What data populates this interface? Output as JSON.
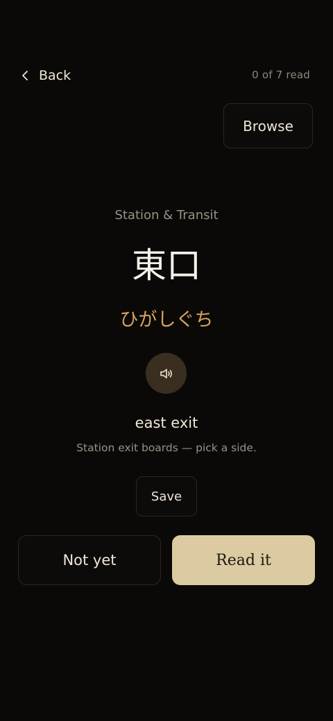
{
  "header": {
    "back_label": "Back",
    "back_icon": "chevron-left-icon",
    "progress_text": "0 of 7 read"
  },
  "toolbar": {
    "browse_label": "Browse"
  },
  "card": {
    "category": "Station & Transit",
    "term": "東口",
    "reading": "ひがしぐち",
    "audio_icon": "speaker-icon",
    "meaning": "east exit",
    "note": "Station exit boards — pick a side.",
    "save_label": "Save"
  },
  "actions": {
    "not_yet_label": "Not yet",
    "read_it_label": "Read it"
  },
  "colors": {
    "background": "#0b0908",
    "accent_reading": "#d6a35c",
    "primary_button": "#dccba2",
    "audio_button_bg": "#3a2e21"
  }
}
